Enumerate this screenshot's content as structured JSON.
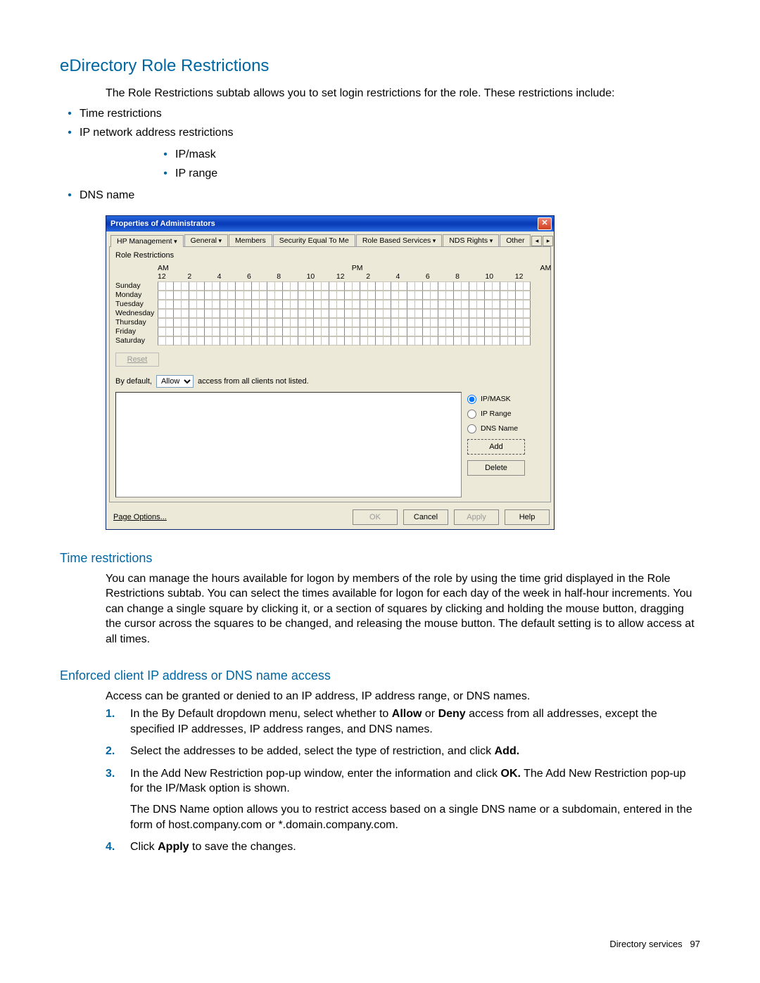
{
  "heading": "eDirectory Role Restrictions",
  "intro": "The Role Restrictions subtab allows you to set login restrictions for the role. These restrictions include:",
  "bullets_lvl1": [
    "Time restrictions",
    "IP network address restrictions",
    "DNS name"
  ],
  "bullets_lvl2": [
    "IP/mask",
    "IP range"
  ],
  "dialog": {
    "title": "Properties of Administrators",
    "close": "✕",
    "tabs": [
      "HP Management",
      "General",
      "Members",
      "Security Equal To Me",
      "Role Based Services",
      "NDS Rights",
      "Other"
    ],
    "tab_scroll_left": "◂",
    "tab_scroll_right": "▸",
    "subtab": "Role Restrictions",
    "am": "AM",
    "pm": "PM",
    "am2": "AM",
    "hours": [
      "12",
      "2",
      "4",
      "6",
      "8",
      "10",
      "12",
      "2",
      "4",
      "6",
      "8",
      "10",
      "12"
    ],
    "days": [
      "Sunday",
      "Monday",
      "Tuesday",
      "Wednesday",
      "Thursday",
      "Friday",
      "Saturday"
    ],
    "reset": "Reset",
    "default_prefix": "By default,",
    "default_select": "Allow",
    "default_suffix": "access from all clients not listed.",
    "radio_ipmask": "IP/MASK",
    "radio_iprange": "IP Range",
    "radio_dns": "DNS Name",
    "btn_add": "Add",
    "btn_delete": "Delete",
    "page_options": "Page Options...",
    "btn_ok": "OK",
    "btn_cancel": "Cancel",
    "btn_apply": "Apply",
    "btn_help": "Help"
  },
  "time_heading": "Time restrictions",
  "time_body": "You can manage the hours available for logon by members of the role by using the time grid displayed in the Role Restrictions subtab. You can select the times available for logon for each day of the week in half-hour increments. You can change a single square by clicking it, or a section of squares by clicking and holding the mouse button, dragging the cursor across the squares to be changed, and releasing the mouse button. The default setting is to allow access at all times.",
  "ip_heading": "Enforced client IP address or DNS name access",
  "ip_body": "Access can be granted or denied to an IP address, IP address range, or DNS names.",
  "steps": {
    "s1a": "In the By Default dropdown menu, select whether to ",
    "s1_allow": "Allow",
    "s1_or": " or ",
    "s1_deny": "Deny",
    "s1b": " access from all addresses, except the specified IP addresses, IP address ranges, and DNS names.",
    "s2a": "Select the addresses to be added, select the type of restriction, and click ",
    "s2_add": "Add.",
    "s3a": "In the Add New Restriction pop-up window, enter the information and click ",
    "s3_ok": "OK.",
    "s3b": " The Add New Restriction pop-up for the IP/Mask option is shown.",
    "s3c": "The DNS Name option allows you to restrict access based on a single DNS name or a subdomain, entered in the form of host.company.com or *.domain.company.com.",
    "s4a": "Click ",
    "s4_apply": "Apply",
    "s4b": " to save the changes."
  },
  "footer_label": "Directory services",
  "footer_page": "97"
}
